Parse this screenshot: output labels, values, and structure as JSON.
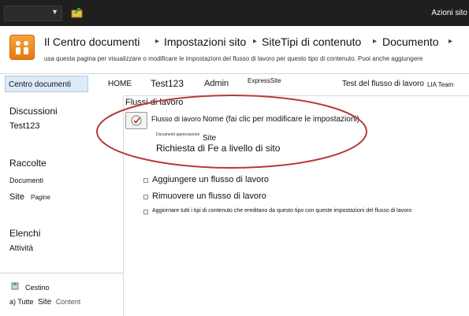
{
  "ribbon": {
    "site_actions": "Azioni sito",
    "site_menu_label": "",
    "nav_icon": "folder-arrow-icon"
  },
  "title_area": {
    "crumbs": [
      "Il Centro documenti",
      "Impostazioni sito",
      "SiteTipi di contenuto",
      "Documento"
    ],
    "separator": "▸",
    "description": "usa questa pagina per visualizzare o modificare le impostazioni del flusso di lavoro per questo tipo di contenuto. Puoi anche aggiungere",
    "logo_icon": "site-logo-icon"
  },
  "topbar": {
    "home_tab": "Centro documenti",
    "links": [
      "HOME",
      "Test123",
      "Admin",
      "ExpressSite",
      "Test del flusso di lavoro",
      "LIA Team"
    ]
  },
  "leftnav": {
    "discussions_heading": "Discussioni",
    "discussions_item": "Test123",
    "collections_heading": "Raccolte",
    "collections_items": [
      "Documenti",
      "Site",
      "Pagine"
    ],
    "lists_heading": "Elenchi",
    "lists_item": "Attività",
    "recycle": "Cestino",
    "all_content_prefix": "a) Tutte",
    "all_content_site": "Site",
    "all_content_word": "Content"
  },
  "main": {
    "title": "Flussi di lavoro",
    "workflow_label": "Flusso di lavoro",
    "workflow_name_hint": "Nome (fai clic per modificare le impostazioni)",
    "tiny_label": "Documenti approvazione",
    "site_word": "Site",
    "request_text": "Richiesta di Fe a livello di sito",
    "actions": [
      "Aggiungere un flusso di lavoro",
      "Rimuovere un flusso di lavoro",
      "Aggiornare tutti i tipi di contenuto che ereditano da questo tipo con queste impostazioni del flusso di lavoro"
    ]
  },
  "colors": {
    "ribbon": "#1f1f1f",
    "tab_highlight": "#ddeaf7",
    "annotation": "#b53a3a",
    "logo": "#f18a1e"
  }
}
